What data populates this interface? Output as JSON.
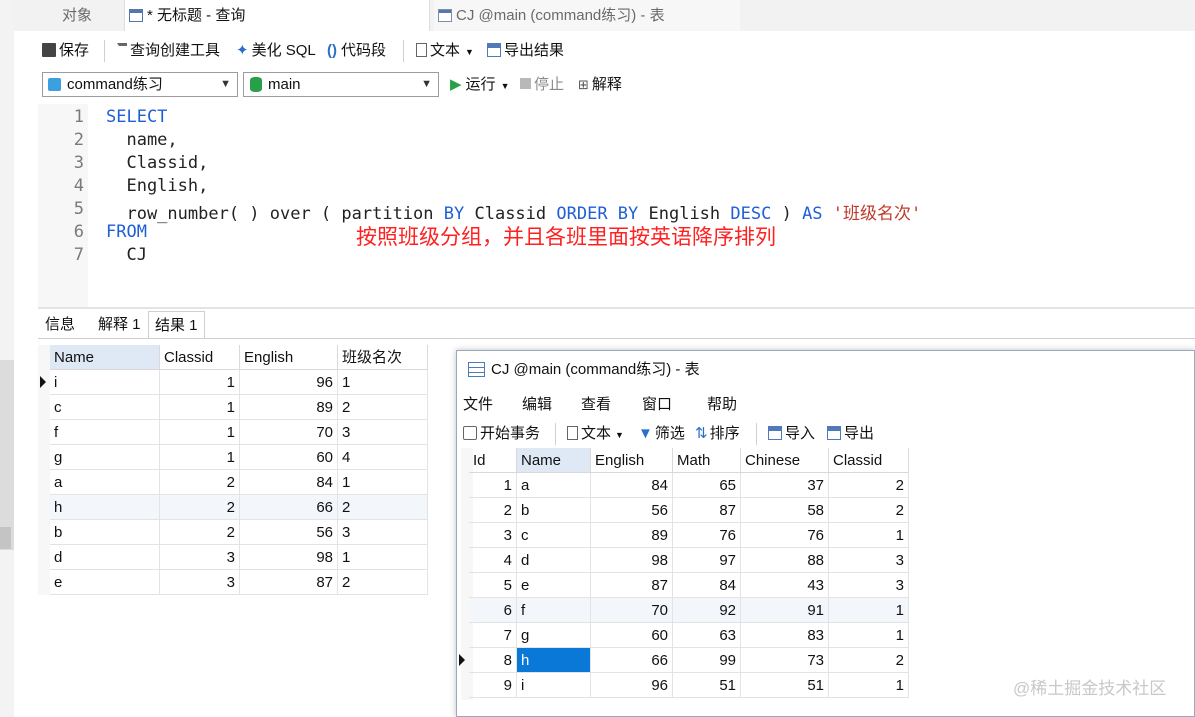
{
  "tabs": [
    {
      "label": "对象",
      "active": false
    },
    {
      "label": "* 无标题 - 查询",
      "active": true
    },
    {
      "label": "CJ @main (command练习) - 表",
      "active": false
    }
  ],
  "toolbar": {
    "save": "保存",
    "query_builder": "查询创建工具",
    "beautify": "美化 SQL",
    "snippet": "代码段",
    "text": "文本",
    "export": "导出结果"
  },
  "connection": {
    "database": "command练习",
    "schema": "main",
    "run": "运行",
    "stop": "停止",
    "explain": "解释"
  },
  "editor": {
    "lines": [
      {
        "n": "1",
        "parts": [
          [
            "kw",
            "SELECT"
          ]
        ]
      },
      {
        "n": "2",
        "parts": [
          [
            "",
            "  name,"
          ]
        ]
      },
      {
        "n": "3",
        "parts": [
          [
            "",
            "  Classid,"
          ]
        ]
      },
      {
        "n": "4",
        "parts": [
          [
            "",
            "  English,"
          ]
        ]
      },
      {
        "n": "5",
        "parts": [
          [
            "",
            "  row_number( ) over ( partition "
          ],
          [
            "kw",
            "BY"
          ],
          [
            "",
            " Classid "
          ],
          [
            "kw",
            "ORDER BY"
          ],
          [
            "",
            " English "
          ],
          [
            "kw",
            "DESC"
          ],
          [
            "",
            " ) "
          ],
          [
            "kw",
            "AS"
          ],
          [
            "",
            " "
          ],
          [
            "str",
            "'班级名次'"
          ]
        ]
      },
      {
        "n": "6",
        "parts": [
          [
            "kw",
            "FROM"
          ]
        ]
      },
      {
        "n": "7",
        "parts": [
          [
            "",
            "  CJ"
          ]
        ]
      }
    ],
    "annotation": "按照班级分组，并且各班里面按英语降序排列"
  },
  "result_tabs": [
    "信息",
    "解释 1",
    "结果 1"
  ],
  "result": {
    "columns": [
      "Name",
      "Classid",
      "English",
      "班级名次"
    ],
    "rows": [
      [
        "i",
        "1",
        "96",
        "1"
      ],
      [
        "c",
        "1",
        "89",
        "2"
      ],
      [
        "f",
        "1",
        "70",
        "3"
      ],
      [
        "g",
        "1",
        "60",
        "4"
      ],
      [
        "a",
        "2",
        "84",
        "1"
      ],
      [
        "h",
        "2",
        "66",
        "2"
      ],
      [
        "b",
        "2",
        "56",
        "3"
      ],
      [
        "d",
        "3",
        "98",
        "1"
      ],
      [
        "e",
        "3",
        "87",
        "2"
      ]
    ]
  },
  "table_window": {
    "title": "CJ @main (command练习) - 表",
    "menu": [
      "文件",
      "编辑",
      "查看",
      "窗口",
      "帮助"
    ],
    "toolbar": {
      "begin_tx": "开始事务",
      "text": "文本",
      "filter": "筛选",
      "sort": "排序",
      "import": "导入",
      "export": "导出"
    },
    "columns": [
      "Id",
      "Name",
      "English",
      "Math",
      "Chinese",
      "Classid"
    ],
    "rows": [
      [
        "1",
        "a",
        "84",
        "65",
        "37",
        "2"
      ],
      [
        "2",
        "b",
        "56",
        "87",
        "58",
        "2"
      ],
      [
        "3",
        "c",
        "89",
        "76",
        "76",
        "1"
      ],
      [
        "4",
        "d",
        "98",
        "97",
        "88",
        "3"
      ],
      [
        "5",
        "e",
        "87",
        "84",
        "43",
        "3"
      ],
      [
        "6",
        "f",
        "70",
        "92",
        "91",
        "1"
      ],
      [
        "7",
        "g",
        "60",
        "63",
        "83",
        "1"
      ],
      [
        "8",
        "h",
        "66",
        "99",
        "73",
        "2"
      ],
      [
        "9",
        "i",
        "96",
        "51",
        "51",
        "1"
      ]
    ]
  },
  "watermark": "@稀土掘金技术社区",
  "colors": {
    "keyword": "#1f5fd6",
    "string": "#c0392b",
    "annotation": "#ff2020",
    "selection": "#0a78d7",
    "header_highlight": "#dfe9f5"
  }
}
